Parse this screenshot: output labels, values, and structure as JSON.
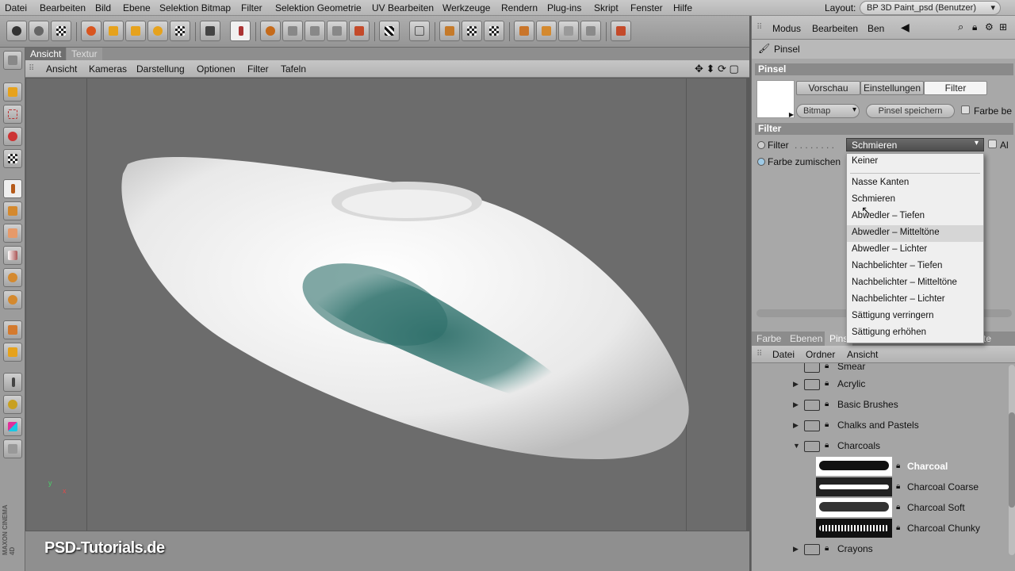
{
  "menubar": {
    "items": [
      "Datei",
      "Bearbeiten",
      "Bild",
      "Ebene",
      "Selektion Bitmap",
      "Filter",
      "Selektion Geometrie",
      "UV Bearbeiten",
      "Werkzeuge",
      "Rendern",
      "Plug-ins",
      "Skript",
      "Fenster",
      "Hilfe"
    ],
    "layout_label": "Layout:",
    "layout_value": "BP 3D Paint_psd (Benutzer)"
  },
  "view": {
    "tabs": [
      "Ansicht",
      "Textur"
    ],
    "menu": [
      "Ansicht",
      "Kameras",
      "Darstellung",
      "Optionen",
      "Filter",
      "Tafeln"
    ]
  },
  "watermark": "PSD-Tutorials.de",
  "maxon": "MAXON CINEMA 4D",
  "attributes": {
    "menu": [
      "Modus",
      "Bearbeiten",
      "Ben"
    ],
    "tool_name": "Pinsel",
    "section_title": "Pinsel",
    "tabs": [
      "Vorschau",
      "Einstellungen",
      "Filter"
    ],
    "bitmap_label": "Bitmap",
    "save_brush_label": "Pinsel speichern",
    "color_checkbox_label": "Farbe be",
    "filter_section": "Filter",
    "filter_label": "Filter",
    "filter_value": "Schmieren",
    "all_label": "Al",
    "blend_label": "Farbe zumischen"
  },
  "dropdown": {
    "options": [
      "Keiner",
      "Nasse Kanten",
      "Schmieren",
      "Abwedler – Tiefen",
      "Abwedler – Mitteltöne",
      "Abwedler – Lichter",
      "Nachbelichter – Tiefen",
      "Nachbelichter – Mitteltöne",
      "Nachbelichter – Lichter",
      "Sättigung verringern",
      "Sättigung erhöhen"
    ],
    "highlighted_index": 4
  },
  "lower": {
    "tabs": [
      "Farbe",
      "Ebenen",
      "Pins",
      "te"
    ],
    "menu": [
      "Datei",
      "Ordner",
      "Ansicht"
    ],
    "tree": {
      "partial": "Smear",
      "folders": [
        "Acrylic",
        "Basic Brushes",
        "Chalks and Pastels",
        "Charcoals"
      ],
      "brushes": [
        "Charcoal",
        "Charcoal Coarse",
        "Charcoal Soft",
        "Charcoal Chunky"
      ],
      "last_folder": "Crayons"
    }
  },
  "colors": {
    "paint": "#2f6f6a",
    "ui_gray": "#a8a8a8"
  }
}
